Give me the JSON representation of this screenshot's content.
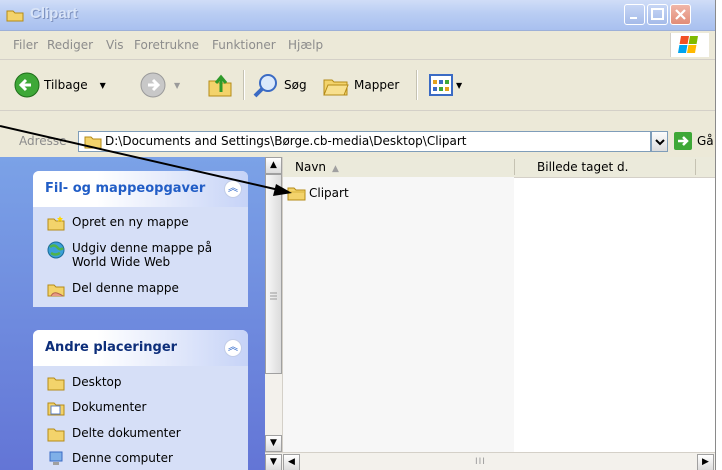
{
  "window": {
    "title": "Clipart"
  },
  "menu": {
    "items": [
      "Filer",
      "Rediger",
      "Vis",
      "Foretrukne",
      "Funktioner",
      "Hjælp"
    ]
  },
  "toolbar": {
    "back_label": "Tilbage",
    "search_label": "Søg",
    "folders_label": "Mapper"
  },
  "address": {
    "label": "Adresse",
    "value": "D:\\Documents and Settings\\Børge.cb-media\\Desktop\\Clipart",
    "go_label": "Gå"
  },
  "tasks_panel": {
    "title": "Fil- og mappeopgaver",
    "items": [
      {
        "label": "Opret en ny mappe",
        "icon": "new-folder-icon"
      },
      {
        "label": "Udgiv denne mappe på World Wide Web",
        "line1": "Udgiv denne mappe på",
        "line2": "World Wide Web",
        "icon": "globe-icon"
      },
      {
        "label": "Del denne mappe",
        "icon": "share-folder-icon"
      }
    ]
  },
  "places_panel": {
    "title": "Andre placeringer",
    "items": [
      {
        "label": "Desktop",
        "icon": "folder-icon"
      },
      {
        "label": "Dokumenter",
        "icon": "documents-icon"
      },
      {
        "label": "Delte dokumenter",
        "icon": "folder-icon"
      },
      {
        "label": "Denne computer",
        "icon": "computer-icon"
      }
    ]
  },
  "file_list": {
    "columns": [
      "Navn",
      "Billede taget d."
    ],
    "rows": [
      {
        "name": "Clipart",
        "icon": "folder-icon"
      }
    ]
  },
  "colors": {
    "folder_yellow": "#f3d36b",
    "task_pane_blue": "#6f8fe0",
    "link_blue": "#215dc6"
  }
}
